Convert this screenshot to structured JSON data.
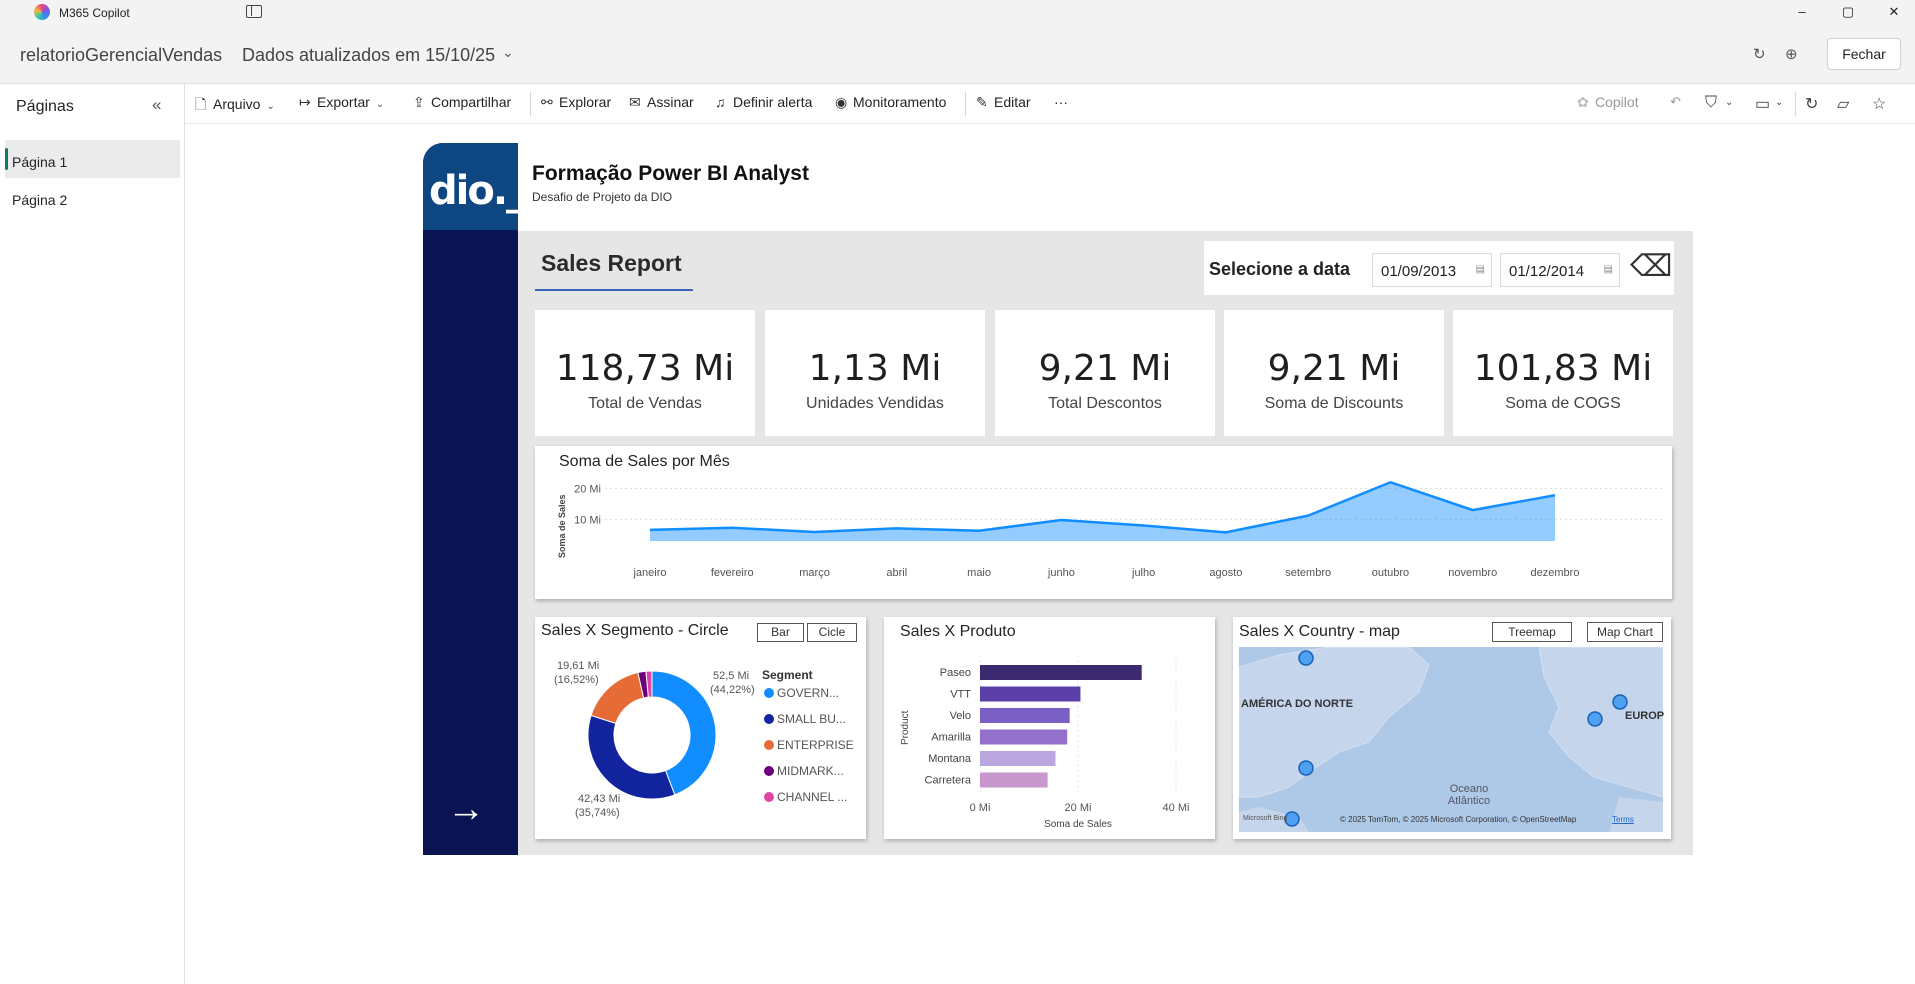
{
  "window": {
    "app_title": "M365 Copilot",
    "minimize": "–",
    "maximize": "▢",
    "close": "✕"
  },
  "header": {
    "report_name": "relatorioGerencialVendas",
    "updated": "Dados atualizados em 15/10/25",
    "close_button": "Fechar"
  },
  "pages_pane": {
    "title": "Páginas",
    "pages": [
      {
        "label": "Página 1",
        "active": true
      },
      {
        "label": "Página 2",
        "active": false
      }
    ]
  },
  "toolbar": {
    "items": [
      {
        "label": "Arquivo",
        "icon": "file-icon"
      },
      {
        "label": "Exportar",
        "icon": "export-icon"
      },
      {
        "label": "Compartilhar",
        "icon": "share-icon"
      },
      {
        "label": "Explorar",
        "icon": "explore-icon"
      },
      {
        "label": "Assinar",
        "icon": "subscribe-icon"
      },
      {
        "label": "Definir alerta",
        "icon": "bell-icon"
      },
      {
        "label": "Monitoramento",
        "icon": "monitor-icon"
      },
      {
        "label": "Editar",
        "icon": "pencil-icon"
      }
    ],
    "more": "···",
    "copilot": "Copilot"
  },
  "report": {
    "title": "Formação Power BI Analyst",
    "subtitle": "Desafio de Projeto da DIO",
    "logo_text": "dio._",
    "section_title": "Sales Report",
    "date_filter": {
      "label": "Selecione a data",
      "start": "01/09/2013",
      "end": "01/12/2014"
    },
    "kpis": [
      {
        "value": "118,73 Mi",
        "label": "Total de Vendas"
      },
      {
        "value": "1,13 Mi",
        "label": "Unidades Vendidas"
      },
      {
        "value": "9,21 Mi",
        "label": "Total Descontos"
      },
      {
        "value": "9,21 Mi",
        "label": "Soma de Discounts"
      },
      {
        "value": "101,83 Mi",
        "label": "Soma de COGS"
      }
    ],
    "visual_buttons": {
      "bar": "Bar",
      "circle": "Cicle",
      "treemap": "Treemap",
      "map_chart": "Map Chart"
    },
    "map": {
      "title": "Sales X Country - map",
      "labels": {
        "north_america": "AMÉRICA DO NORTE",
        "europe": "EUROP",
        "ocean": "Oceano\nAtlântico"
      },
      "attribution": "© 2025 TomTom, © 2025 Microsoft Corporation, © OpenStreetMap",
      "terms": "Terms",
      "bing": "Microsoft Bing"
    }
  },
  "chart_data": [
    {
      "type": "area",
      "title": "Soma de Sales por Mês",
      "ylabel": "Soma de Sales",
      "xlabel": "",
      "categories": [
        "janeiro",
        "fevereiro",
        "março",
        "abril",
        "maio",
        "junho",
        "julho",
        "agosto",
        "setembro",
        "outubro",
        "novembro",
        "dezembro"
      ],
      "values": [
        6.6,
        7.3,
        5.9,
        7.1,
        6.3,
        9.8,
        8.0,
        5.8,
        11.2,
        22.0,
        13.0,
        17.8
      ],
      "y_ticks": [
        {
          "value": 10,
          "label": "10 Mi"
        },
        {
          "value": 20,
          "label": "20 Mi"
        }
      ],
      "ylim": [
        3,
        25
      ],
      "color": "#118dff"
    },
    {
      "type": "pie",
      "title": "Sales X Segmento - Circle",
      "legend_title": "Segment",
      "categories": [
        "GOVERN...",
        "SMALL BU...",
        "ENTERPRISE",
        "MIDMARK...",
        "CHANNEL ..."
      ],
      "values": [
        52.5,
        42.43,
        19.61,
        2.4,
        1.8
      ],
      "colors": [
        "#118dff",
        "#12239e",
        "#e66c37",
        "#6b007b",
        "#e044a7"
      ],
      "data_labels": [
        {
          "value": "52,5 Mi",
          "pct": "(44,22%)"
        },
        {
          "value": "42,43 Mi",
          "pct": "(35,74%)"
        },
        {
          "value": "19,61 Mi",
          "pct": "(16,52%)"
        }
      ]
    },
    {
      "type": "bar",
      "title": "Sales X Produto",
      "categories": [
        "Paseo",
        "VTT",
        "Velo",
        "Amarilla",
        "Montana",
        "Carretera"
      ],
      "values": [
        33.0,
        20.5,
        18.3,
        17.8,
        15.4,
        13.8
      ],
      "xlabel": "Soma de Sales",
      "ylabel": "Product",
      "x_ticks": [
        {
          "value": 0,
          "label": "0 Mi"
        },
        {
          "value": 20,
          "label": "20 Mi"
        },
        {
          "value": 40,
          "label": "40 Mi"
        }
      ],
      "xlim": [
        0,
        45
      ],
      "colors": [
        "#3b2a6e",
        "#5a3fa8",
        "#7a5fc4",
        "#9270cc",
        "#bba7e0",
        "#c898cc"
      ]
    }
  ]
}
